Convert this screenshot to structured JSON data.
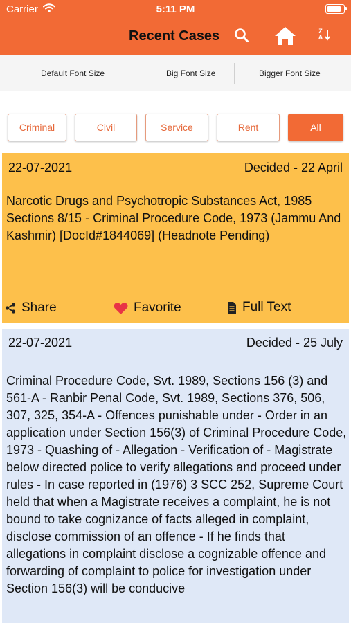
{
  "status": {
    "carrier": "Carrier",
    "time": "5:11 PM"
  },
  "header": {
    "title": "Recent Cases",
    "icons": [
      "search-icon",
      "home-icon",
      "sort-icon"
    ],
    "sort_letters": "Z\nA",
    "color": "#f26a35"
  },
  "font_options": [
    "Default Font Size",
    "Big Font Size",
    "Bigger Font Size"
  ],
  "filters": [
    "Criminal",
    "Civil",
    "Service",
    "Rent",
    "All"
  ],
  "selected_filter": "All",
  "cases": [
    {
      "date": "22-07-2021",
      "decided": "Decided - 22 April",
      "text": "Narcotic Drugs and Psychotropic Substances Act, 1985 Sections 8/15 - Criminal Procedure Code, 1973 (Jammu And Kashmir) [DocId#1844069] (Headnote Pending)",
      "actions": {
        "share": "Share",
        "favorite": "Favorite",
        "full_text": "Full Text"
      },
      "color": "#fdc04b"
    },
    {
      "date": "22-07-2021",
      "decided": "Decided - 25 July",
      "text": "Criminal Procedure Code, Svt. 1989, Sections 156 (3) and 561-A - Ranbir Penal Code, Svt. 1989, Sections 376, 506, 307, 325, 354-A - Offences punishable under - Order in an application under Section 156(3) of Criminal Procedure Code, 1973 - Quashing of - Allegation - Verification of - Magistrate below directed police to verify allegations and proceed under rules - In case reported in (1976) 3 SCC 252, Supreme Court held that when a Magistrate receives a complaint, he is not bound to take cognizance of facts alleged in complaint, disclose commission of an offence - If he finds that allegations in complaint disclose a cognizable offence and forwarding of complaint to police for investigation under Section 156(3) will be conducive",
      "color": "#dfe8f7"
    }
  ]
}
